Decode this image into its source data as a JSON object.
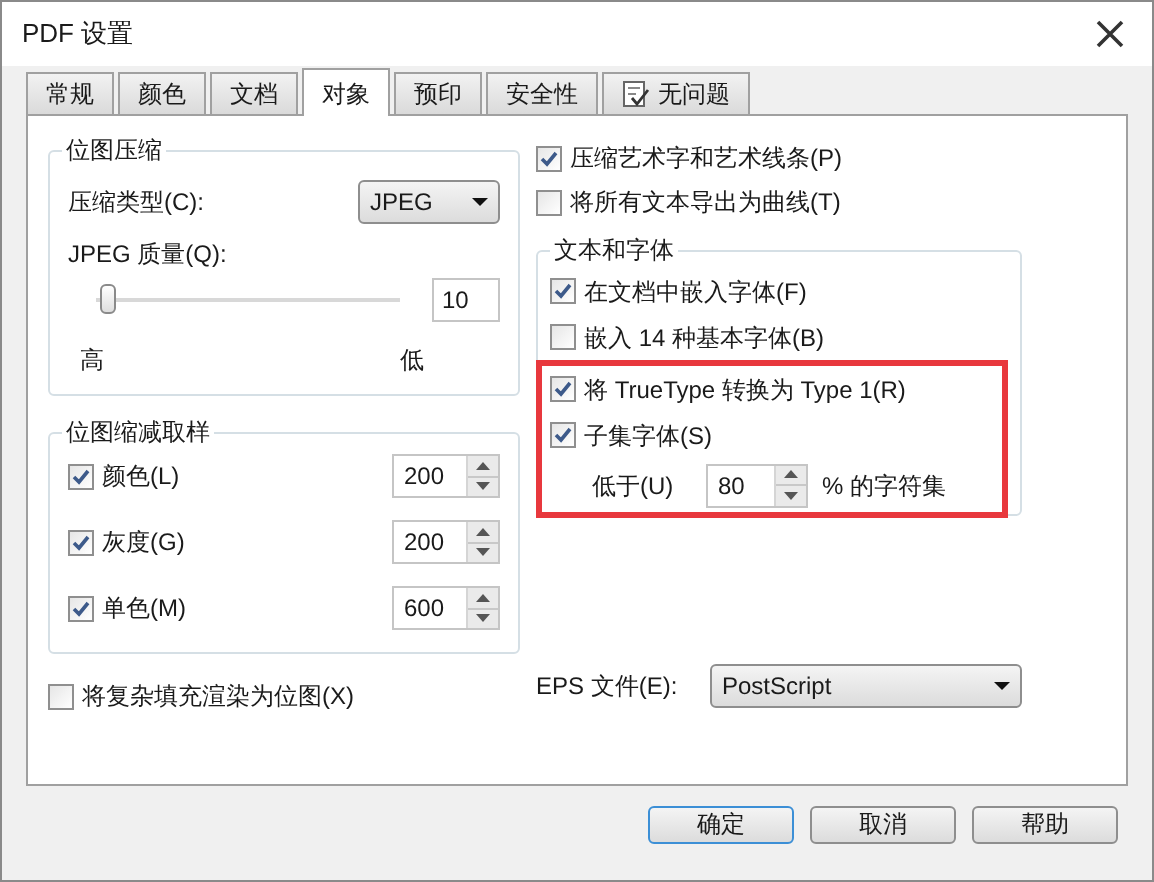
{
  "window": {
    "title": "PDF 设置"
  },
  "tabs": [
    {
      "label": "常规",
      "selected": false,
      "kind": "text"
    },
    {
      "label": "颜色",
      "selected": false,
      "kind": "text"
    },
    {
      "label": "文档",
      "selected": false,
      "kind": "text"
    },
    {
      "label": "对象",
      "selected": true,
      "kind": "text"
    },
    {
      "label": "预印",
      "selected": false,
      "kind": "text"
    },
    {
      "label": "安全性",
      "selected": false,
      "kind": "text"
    },
    {
      "label": "无问题",
      "selected": false,
      "kind": "icon"
    }
  ],
  "bitmap_compression": {
    "title": "位图压缩",
    "type_label": "压缩类型(C):",
    "type_value": "JPEG",
    "quality_label": "JPEG 质量(Q):",
    "quality": {
      "level": 0.04,
      "value": "10",
      "left_label": "高",
      "right_label": "低"
    }
  },
  "downsampling": {
    "title": "位图缩减取样",
    "items": [
      {
        "label": "颜色(L)",
        "checked": true,
        "value": "200"
      },
      {
        "label": "灰度(G)",
        "checked": true,
        "value": "200"
      },
      {
        "label": "单色(M)",
        "checked": true,
        "value": "600"
      }
    ]
  },
  "render_complex": {
    "label": "将复杂填充渲染为位图(X)",
    "checked": false
  },
  "right_options": [
    {
      "label": "压缩艺术字和艺术线条(P)",
      "checked": true
    },
    {
      "label": "将所有文本导出为曲线(T)",
      "checked": false
    }
  ],
  "text_fonts": {
    "title": "文本和字体",
    "options": [
      {
        "label": "在文档中嵌入字体(F)",
        "checked": true,
        "highlighted": false
      },
      {
        "label": "嵌入 14 种基本字体(B)",
        "checked": false,
        "highlighted": false
      },
      {
        "label": "将 TrueType 转换为 Type 1(R)",
        "checked": true,
        "highlighted": true
      },
      {
        "label": "子集字体(S)",
        "checked": true,
        "highlighted": true
      }
    ],
    "below": {
      "label": "低于(U)",
      "value": "80",
      "suffix": "% 的字符集"
    }
  },
  "eps": {
    "label": "EPS 文件(E):",
    "value": "PostScript"
  },
  "buttons": [
    {
      "label": "确定",
      "default": true
    },
    {
      "label": "取消",
      "default": false
    },
    {
      "label": "帮助",
      "default": false
    }
  ]
}
